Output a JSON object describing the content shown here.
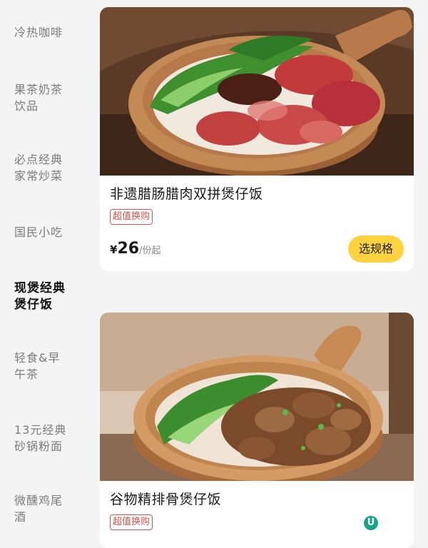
{
  "sidebar": {
    "categories": [
      {
        "label": "冷热咖啡"
      },
      {
        "label": "果茶奶茶饮品"
      },
      {
        "label": "必点经典家常炒菜"
      },
      {
        "label": "国民小吃"
      },
      {
        "label": "现煲经典煲仔饭"
      },
      {
        "label": "轻食&早午茶"
      },
      {
        "label": "13元经典砂锅粉面"
      },
      {
        "label": "微醺鸡尾酒"
      }
    ],
    "active_index": 4
  },
  "products": [
    {
      "name": "非遗腊肠腊肉双拼煲仔饭",
      "badge": "超值换购",
      "currency": "¥",
      "price": "26",
      "unit": "/份起",
      "button": "选规格"
    },
    {
      "name": "谷物精排骨煲仔饭",
      "badge": "超值换购",
      "logo_text": "U"
    }
  ],
  "colors": {
    "accent_button": "#ffd23f",
    "badge": "#d9534f",
    "active_category": "#111111",
    "inactive_category": "#7c7c7c"
  }
}
